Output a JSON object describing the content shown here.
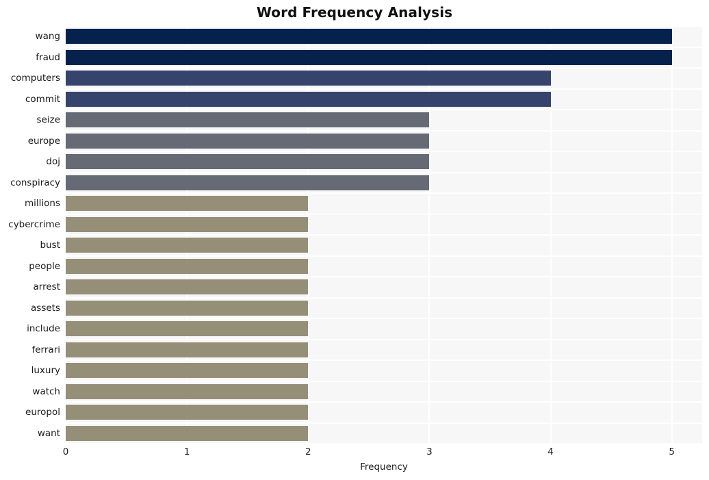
{
  "chart_data": {
    "type": "bar",
    "orientation": "horizontal",
    "title": "Word Frequency Analysis",
    "xlabel": "Frequency",
    "ylabel": "",
    "xlim": [
      0,
      5.25
    ],
    "ylim": [
      0,
      20
    ],
    "xticks": [
      "0",
      "1",
      "2",
      "3",
      "4",
      "5"
    ],
    "xtick_values": [
      0,
      1,
      2,
      3,
      4,
      5
    ],
    "grid": true,
    "legend": false,
    "categories": [
      "wang",
      "fraud",
      "computers",
      "commit",
      "seize",
      "europe",
      "doj",
      "conspiracy",
      "millions",
      "cybercrime",
      "bust",
      "people",
      "arrest",
      "assets",
      "include",
      "ferrari",
      "luxury",
      "watch",
      "europol",
      "want"
    ],
    "values": [
      5,
      5,
      4,
      4,
      3,
      3,
      3,
      3,
      2,
      2,
      2,
      2,
      2,
      2,
      2,
      2,
      2,
      2,
      2,
      2
    ],
    "bar_colors": [
      "#04224c",
      "#04224c",
      "#36446d",
      "#36446d",
      "#666a74",
      "#666a74",
      "#666a74",
      "#666a74",
      "#968f78",
      "#968f78",
      "#968f78",
      "#968f78",
      "#968f78",
      "#968f78",
      "#968f78",
      "#968f78",
      "#968f78",
      "#968f78",
      "#968f78",
      "#968f78"
    ]
  },
  "style": {
    "plot_background": "#f7f7f8",
    "grid_color": "#ffffff",
    "figure_background": "#ffffff",
    "text_color": "#1a1a1a"
  }
}
